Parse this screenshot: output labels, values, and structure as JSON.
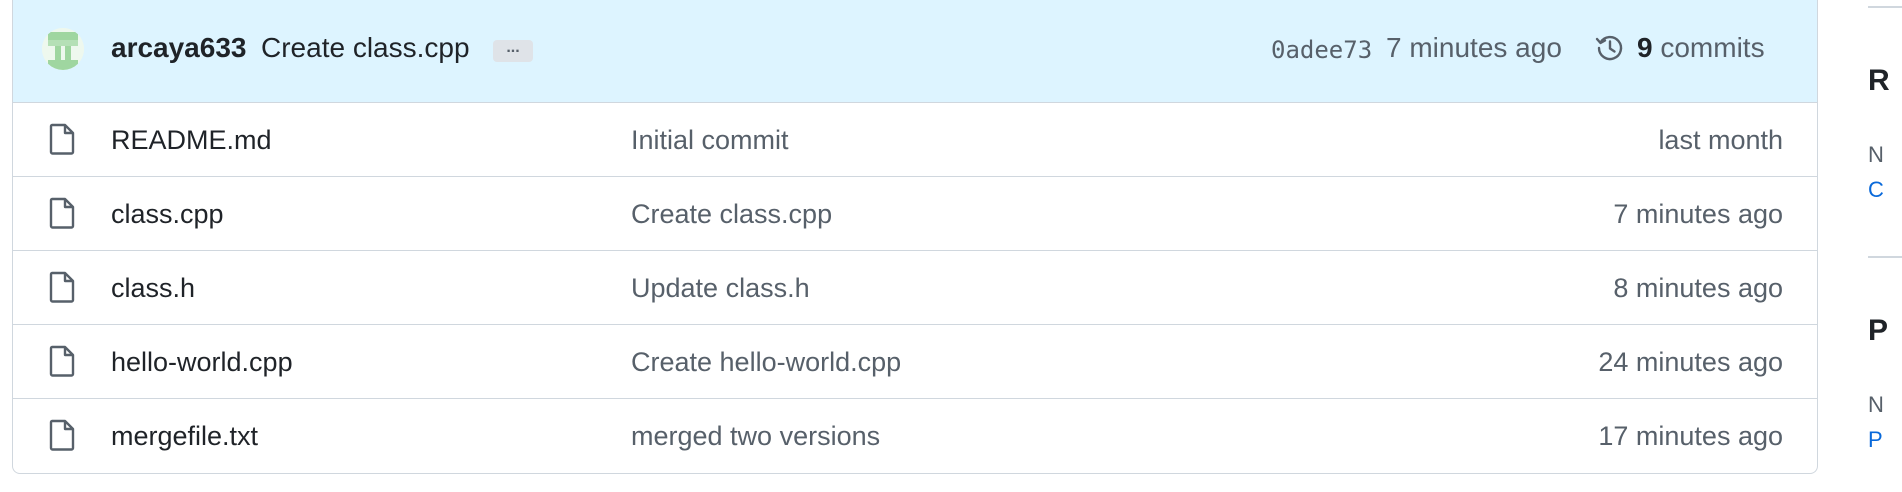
{
  "latest_commit": {
    "author": "arcaya633",
    "message": "Create class.cpp",
    "ellipsis": "...",
    "sha": "0adee73",
    "time": "7 minutes ago",
    "commit_count": "9",
    "commit_label": "commits"
  },
  "files": [
    {
      "name": "README.md",
      "message": "Initial commit",
      "time": "last month"
    },
    {
      "name": "class.cpp",
      "message": "Create class.cpp",
      "time": "7 minutes ago"
    },
    {
      "name": "class.h",
      "message": "Update class.h",
      "time": "8 minutes ago"
    },
    {
      "name": "hello-world.cpp",
      "message": "Create hello-world.cpp",
      "time": "24 minutes ago"
    },
    {
      "name": "mergefile.txt",
      "message": "merged two versions",
      "time": "17 minutes ago"
    }
  ],
  "sidebar_partial": {
    "heading1": "R",
    "small1": "N",
    "link1": "C",
    "heading2": "P",
    "small2": "N",
    "link2": "P"
  },
  "icons": {
    "avatar": "identicon-avatar",
    "history": "history-icon",
    "file": "file-icon"
  },
  "colors": {
    "commit_bar_bg": "#ddf4ff",
    "border": "#d0d7de",
    "muted_text": "#57606a",
    "link": "#0969da"
  }
}
